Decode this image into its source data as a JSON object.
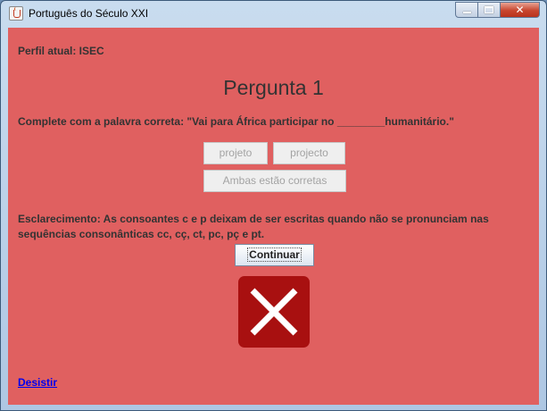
{
  "window": {
    "title": "Português do Século XXI",
    "icon": "java-cup-icon",
    "controls": [
      "minimize",
      "maximize",
      "close"
    ]
  },
  "profile": {
    "text": "Perfil atual: ISEC"
  },
  "question": {
    "heading": "Pergunta 1",
    "prompt": "Complete com a palavra correta: \"Vai para África participar no ________humanitário.\""
  },
  "options": [
    {
      "label": "projeto",
      "enabled": false
    },
    {
      "label": "projecto",
      "enabled": false
    },
    {
      "label": "Ambas estão corretas",
      "enabled": false
    }
  ],
  "clarification": {
    "text": "Esclarecimento: As consoantes c e p deixam de ser escritas quando não se pronunciam nas sequências consonânticas cc, cç, ct, pc, pç e pt."
  },
  "continue_button": {
    "label": "Continuar"
  },
  "result": {
    "icon": "wrong-answer-icon",
    "correct": false
  },
  "quit_link": {
    "label": "Desistir"
  },
  "colors": {
    "panel_background": "#e06060",
    "wrong_icon_background": "#a81010",
    "link": "#0000ee"
  }
}
